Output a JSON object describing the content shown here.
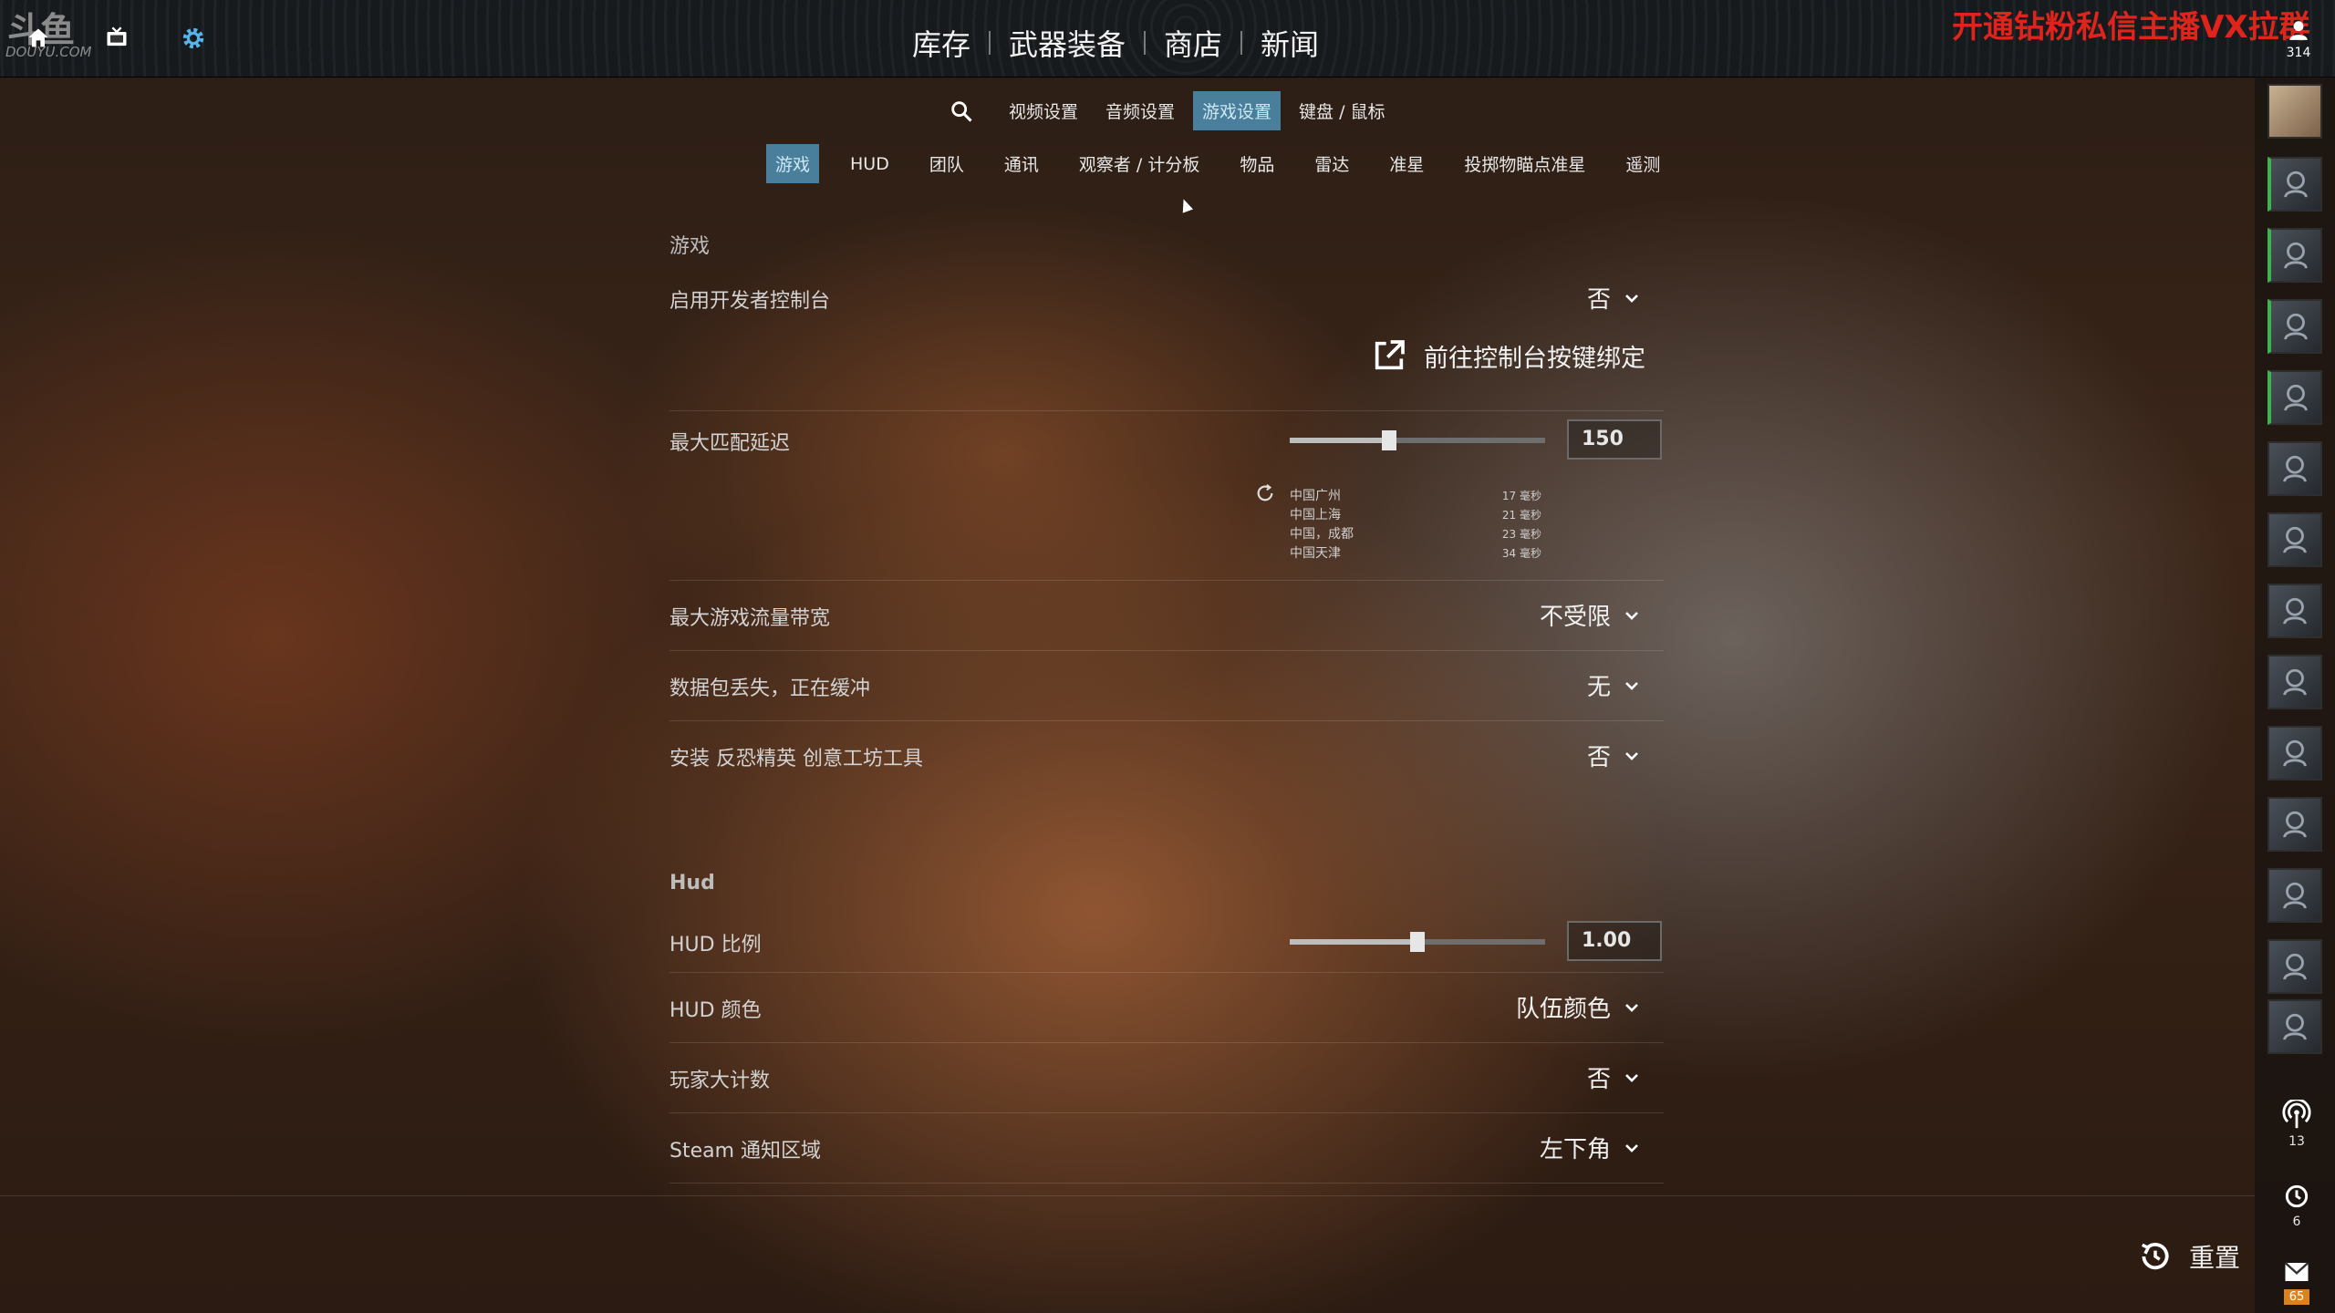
{
  "brand": {
    "logo": "斗鱼",
    "domain": "DOUYU.COM"
  },
  "main_nav": [
    "库存",
    "武器装备",
    "商店",
    "新闻"
  ],
  "promo": "开通钻粉私信主播VX拉群",
  "settings_tabs": [
    {
      "label": "视频设置",
      "active": false
    },
    {
      "label": "音频设置",
      "active": false
    },
    {
      "label": "游戏设置",
      "active": true
    },
    {
      "label": "键盘 / 鼠标",
      "active": false
    }
  ],
  "sub_tabs": [
    {
      "label": "游戏",
      "active": true
    },
    {
      "label": "HUD",
      "active": false
    },
    {
      "label": "团队",
      "active": false
    },
    {
      "label": "通讯",
      "active": false
    },
    {
      "label": "观察者 / 计分板",
      "active": false
    },
    {
      "label": "物品",
      "active": false
    },
    {
      "label": "雷达",
      "active": false
    },
    {
      "label": "准星",
      "active": false
    },
    {
      "label": "投掷物瞄点准星",
      "active": false
    },
    {
      "label": "遥测",
      "active": false
    }
  ],
  "game_section": {
    "title": "游戏",
    "dev_console": {
      "label": "启用开发者控制台",
      "value": "否"
    },
    "console_link": "前往控制台按键绑定",
    "max_ping": {
      "label": "最大匹配延迟",
      "value": "150",
      "slider_fraction": 0.39,
      "pings": [
        {
          "region": "中国广州",
          "ms": "17 毫秒"
        },
        {
          "region": "中国上海",
          "ms": "21 毫秒"
        },
        {
          "region": "中国，成都",
          "ms": "23 毫秒"
        },
        {
          "region": "中国天津",
          "ms": "34 毫秒"
        }
      ]
    },
    "bandwidth": {
      "label": "最大游戏流量带宽",
      "value": "不受限"
    },
    "packet_loss": {
      "label": "数据包丢失，正在缓冲",
      "value": "无"
    },
    "workshop": {
      "label": "安装 反恐精英 创意工坊工具",
      "value": "否"
    }
  },
  "hud_section": {
    "title": "Hud",
    "hud_scale": {
      "label": "HUD 比例",
      "value": "1.00",
      "slider_fraction": 0.5
    },
    "hud_color": {
      "label": "HUD 颜色",
      "value": "队伍颜色"
    },
    "player_count": {
      "label": "玩家大计数",
      "value": "否"
    },
    "steam_notify": {
      "label": "Steam 通知区域",
      "value": "左下角"
    }
  },
  "rail": {
    "friends_count": "314",
    "broadcast_count": "13",
    "history_count": "6",
    "mail_count": "65"
  },
  "footer": {
    "reset_label": "重置"
  },
  "colors": {
    "accent_tab": "#4a7f9c",
    "promo": "#e0241c",
    "online": "#3fb34f",
    "badge": "#d9821e"
  }
}
